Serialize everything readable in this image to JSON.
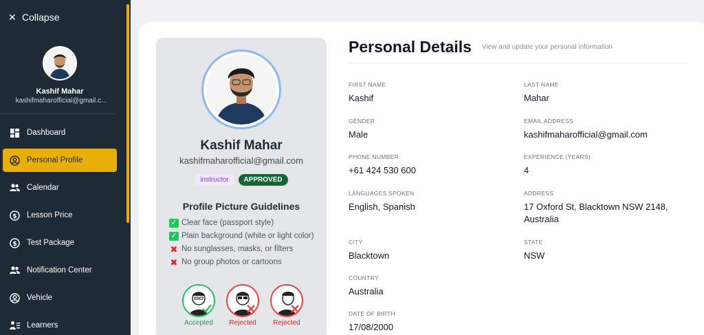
{
  "sidebar": {
    "collapse_label": "Collapse",
    "user_name": "Kashif Mahar",
    "user_email": "kashifmaharofficial@gmail.c...",
    "items": [
      {
        "label": "Dashboard",
        "icon": "dashboard-icon"
      },
      {
        "label": "Personal Profile",
        "icon": "user-circle-icon",
        "active": true
      },
      {
        "label": "Calendar",
        "icon": "people-icon"
      },
      {
        "label": "Lesson Price",
        "icon": "dollar-icon"
      },
      {
        "label": "Test Package",
        "icon": "dollar-icon"
      },
      {
        "label": "Notification Center",
        "icon": "people-icon"
      },
      {
        "label": "Vehicle",
        "icon": "user-circle-icon"
      },
      {
        "label": "Learners",
        "icon": "person-list-icon"
      }
    ],
    "accent": "#e8b007"
  },
  "profile": {
    "name": "Kashif Mahar",
    "email": "kashifmaharofficial@gmail.com",
    "role": "instructor",
    "status": "APPROVED",
    "guidelines_title": "Profile Picture Guidelines",
    "guidelines": [
      {
        "ok": true,
        "text": "Clear face (passport style)"
      },
      {
        "ok": true,
        "text": "Plain background (white or light color)"
      },
      {
        "ok": false,
        "text": "No sunglasses, masks, or filters"
      },
      {
        "ok": false,
        "text": "No group photos or cartoons"
      }
    ],
    "samples": [
      {
        "label": "Accepted",
        "kind": "acc"
      },
      {
        "label": "Rejected",
        "kind": "rej"
      },
      {
        "label": "Rejected",
        "kind": "rej"
      }
    ]
  },
  "details": {
    "title": "Personal Details",
    "subtitle": "View and update your personal information",
    "fields": {
      "first_name": {
        "label": "FIRST NAME",
        "value": "Kashif"
      },
      "last_name": {
        "label": "LAST NAME",
        "value": "Mahar"
      },
      "gender": {
        "label": "GENDER",
        "value": "Male"
      },
      "email": {
        "label": "EMAIL ADDRESS",
        "value": "kashifmaharofficial@gmail.com"
      },
      "phone": {
        "label": "PHONE NUMBER",
        "value": "+61 424 530 600"
      },
      "experience": {
        "label": "EXPERIENCE (YEARS)",
        "value": "4"
      },
      "languages": {
        "label": "LANGUAGES SPOKEN",
        "value": "English, Spanish"
      },
      "address": {
        "label": "ADDRESS",
        "value": "17 Oxford St, Blacktown NSW 2148, Australia"
      },
      "city": {
        "label": "CITY",
        "value": "Blacktown"
      },
      "state": {
        "label": "STATE",
        "value": "NSW"
      },
      "country": {
        "label": "COUNTRY",
        "value": "Australia"
      },
      "dob": {
        "label": "DATE OF BIRTH",
        "value": "17/08/2000"
      }
    }
  }
}
